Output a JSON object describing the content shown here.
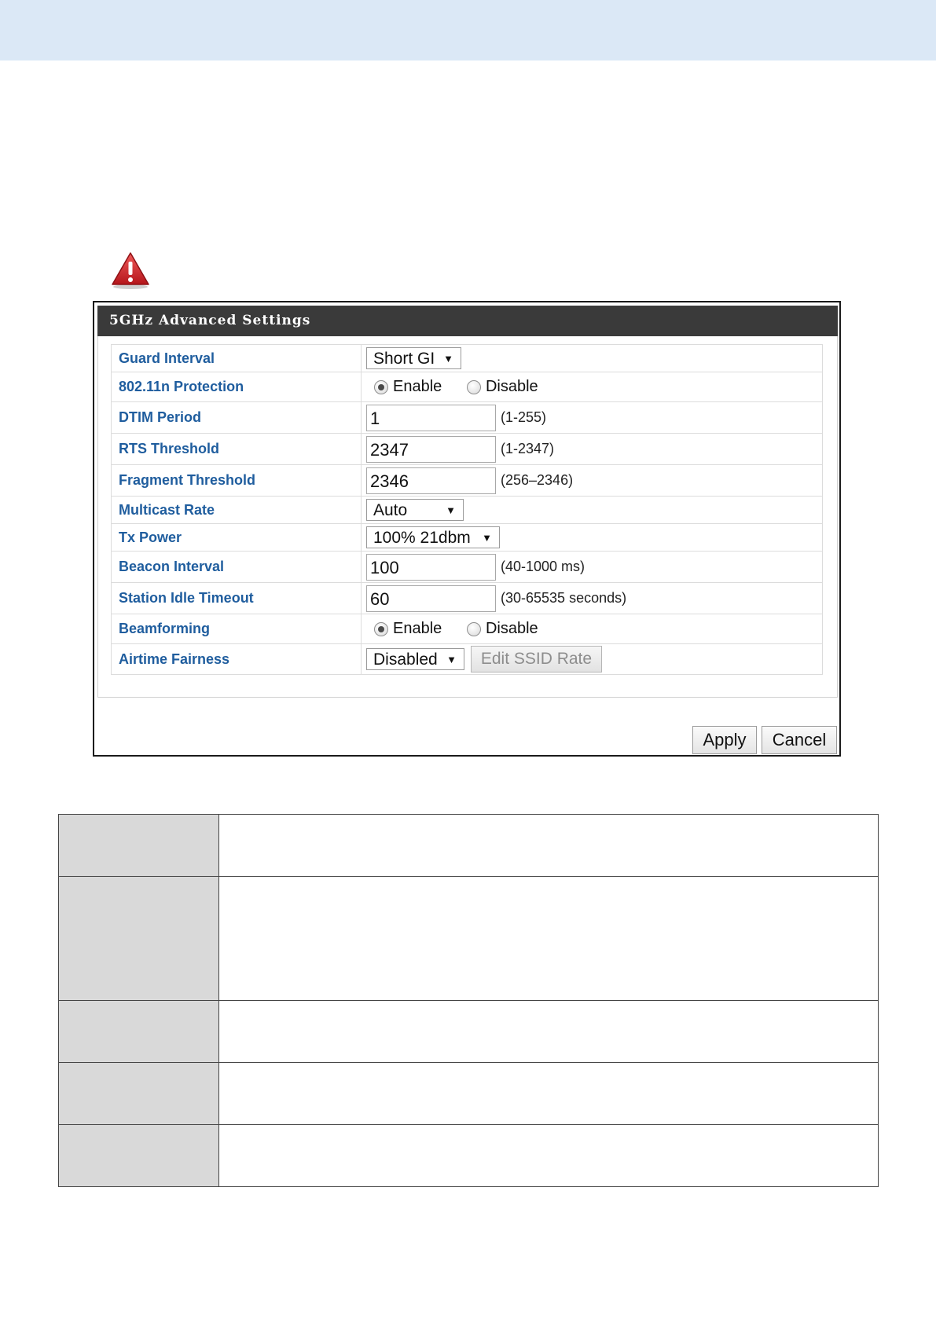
{
  "panel": {
    "title": "5GHz Advanced Settings"
  },
  "rows": {
    "guard_interval": {
      "label": "Guard Interval",
      "value": "Short GI"
    },
    "protection": {
      "label": "802.11n Protection",
      "enable": "Enable",
      "disable": "Disable",
      "selected": "Enable"
    },
    "dtim": {
      "label": "DTIM Period",
      "value": "1",
      "hint": "(1-255)"
    },
    "rts": {
      "label": "RTS Threshold",
      "value": "2347",
      "hint": "(1-2347)"
    },
    "fragment": {
      "label": "Fragment Threshold",
      "value": "2346",
      "hint": "(256–2346)"
    },
    "multicast": {
      "label": "Multicast Rate",
      "value": "Auto"
    },
    "txpower": {
      "label": "Tx Power",
      "value": "100% 21dbm"
    },
    "beacon": {
      "label": "Beacon Interval",
      "value": "100",
      "hint": "(40-1000 ms)"
    },
    "idle": {
      "label": "Station Idle Timeout",
      "value": "60",
      "hint": "(30-65535 seconds)"
    },
    "beamforming": {
      "label": "Beamforming",
      "enable": "Enable",
      "disable": "Disable",
      "selected": "Enable"
    },
    "airtime": {
      "label": "Airtime Fairness",
      "value": "Disabled",
      "edit_button": "Edit SSID Rate"
    }
  },
  "buttons": {
    "apply": "Apply",
    "cancel": "Cancel"
  },
  "icons": {
    "dropdown": "▼"
  },
  "colors": {
    "label_blue": "#1f5d9e",
    "title_bar": "#3a3a3a",
    "top_band": "#dbe8f6",
    "warning_red": "#d8242a"
  }
}
